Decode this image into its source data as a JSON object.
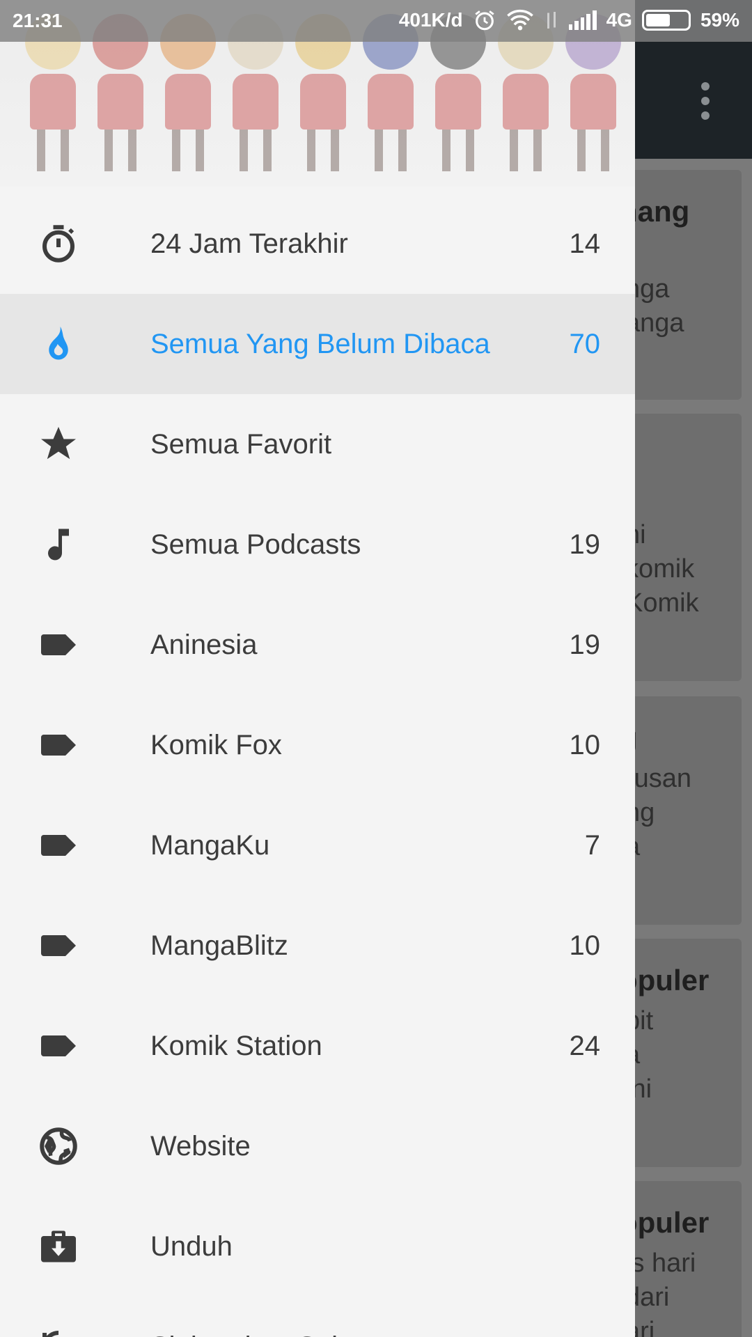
{
  "status_bar": {
    "time": "21:31",
    "speed": "401K/d",
    "network": "4G",
    "battery": "59%",
    "battery_level": 0.59
  },
  "background": {
    "cards": [
      {
        "title": "nang",
        "lines": [
          "i",
          "nga",
          "anga"
        ]
      },
      {
        "title": "",
        "lines": [
          "ni",
          "komik",
          "Komik"
        ]
      },
      {
        "title": "g",
        "lines": [
          "rusan",
          "ng",
          "a"
        ]
      },
      {
        "title": "opuler",
        "lines": [
          "bit",
          "a",
          "ini"
        ]
      },
      {
        "title": "opuler",
        "lines": [
          "is hari",
          "dari",
          "ari"
        ]
      }
    ]
  },
  "drawer": {
    "items": [
      {
        "label": "24 Jam Terakhir",
        "count": "14",
        "icon": "stopwatch-icon"
      },
      {
        "label": "Semua Yang Belum Dibaca",
        "count": "70",
        "icon": "flame-icon",
        "active": true
      },
      {
        "label": "Semua Favorit",
        "count": "",
        "icon": "star-icon"
      },
      {
        "label": "Semua Podcasts",
        "count": "19",
        "icon": "music-note-icon"
      },
      {
        "label": "Aninesia",
        "count": "19",
        "icon": "label-tag-icon"
      },
      {
        "label": "Komik Fox",
        "count": "10",
        "icon": "label-tag-icon"
      },
      {
        "label": "MangaKu",
        "count": "7",
        "icon": "label-tag-icon"
      },
      {
        "label": "MangaBlitz",
        "count": "10",
        "icon": "label-tag-icon"
      },
      {
        "label": "Komik Station",
        "count": "24",
        "icon": "label-tag-icon"
      },
      {
        "label": "Website",
        "count": "",
        "icon": "globe-icon"
      },
      {
        "label": "Unduh",
        "count": "",
        "icon": "download-box-icon"
      },
      {
        "label": "Sinkronkan Sekarang",
        "count": "",
        "icon": "sync-icon"
      }
    ]
  },
  "colors": {
    "accent": "#2196f3",
    "icon": "#3c3c3c",
    "drawer_bg": "#f4f4f4",
    "toolbar": "#1d2327"
  }
}
